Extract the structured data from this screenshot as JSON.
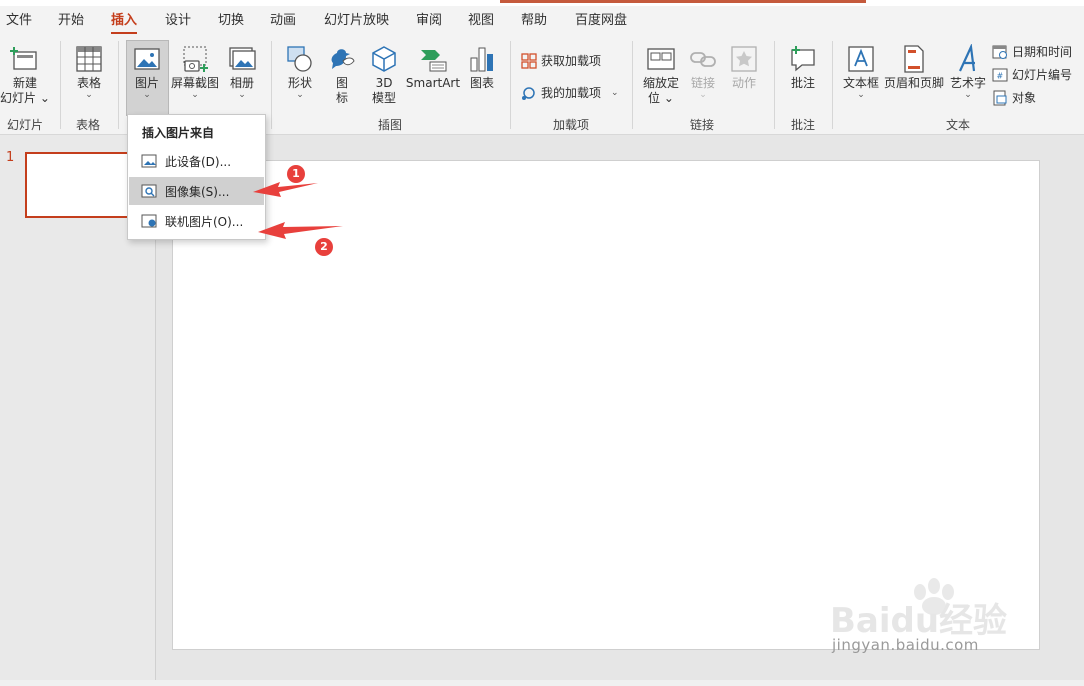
{
  "tabs": [
    "文件",
    "开始",
    "插入",
    "设计",
    "切换",
    "动画",
    "幻灯片放映",
    "审阅",
    "视图",
    "帮助",
    "百度网盘"
  ],
  "ribbon": {
    "new_slide": {
      "line1": "新建",
      "line2": "幻灯片"
    },
    "table": "表格",
    "pictures": "图片",
    "screenshot": "屏幕截图",
    "album": "相册",
    "shapes": "形状",
    "icons": {
      "line1": "图",
      "line2": "标"
    },
    "models3d": {
      "line1": "3D",
      "line2": "模型"
    },
    "smartart": "SmartArt",
    "chart": "图表",
    "get_addins": "获取加载项",
    "my_addins": "我的加载项",
    "zoom": {
      "line1": "缩放定",
      "line2": "位"
    },
    "link": "链接",
    "action": "动作",
    "comment": "批注",
    "textbox": "文本框",
    "header_footer": "页眉和页脚",
    "wordart": "艺术字",
    "date_time": "日期和时间",
    "slide_number": "幻灯片编号",
    "object": "对象"
  },
  "groups": {
    "slides": "幻灯片",
    "tables": "表格",
    "illustrations": "插图",
    "addins": "加载项",
    "links": "链接",
    "comments": "批注",
    "text": "文本"
  },
  "thumbnail": {
    "number": "1"
  },
  "dropdown": {
    "title": "插入图片来自",
    "items": [
      "此设备(D)...",
      "图像集(S)...",
      "联机图片(O)..."
    ]
  },
  "badges": [
    "1",
    "2"
  ],
  "watermark": {
    "brand": "Baidu经验",
    "url": "jingyan.baidu.com"
  },
  "colors": {
    "accent": "#c43e1c",
    "arrow": "#e8403c",
    "icon_blue": "#2e74b5"
  }
}
